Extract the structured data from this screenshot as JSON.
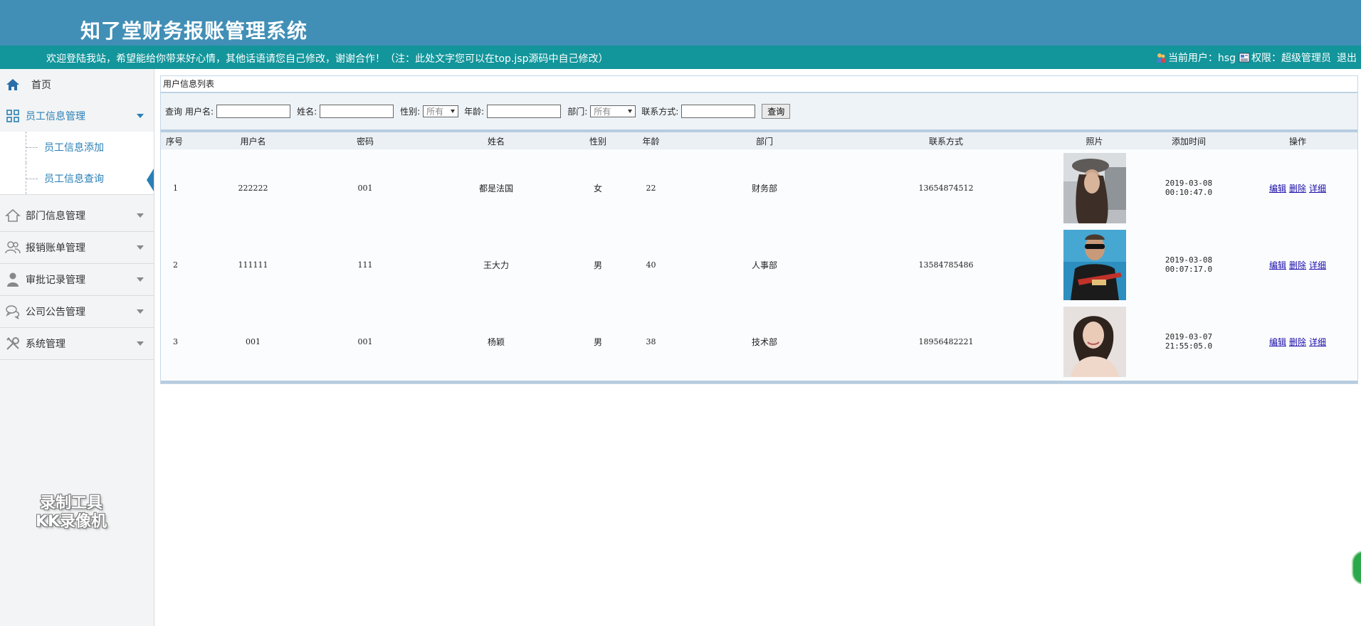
{
  "app": {
    "title": "知了堂财务报账管理系统",
    "welcome": "欢迎登陆我站，希望能给你带来好心情，其他话语请您自己修改，谢谢合作！（注：此处文字您可以在top.jsp源码中自己修改）",
    "current_user_label": "当前用户：hsg",
    "permission_label": "权限：超级管理员",
    "logout": "退出"
  },
  "sidebar": {
    "home": "首页",
    "groups": [
      {
        "label": "员工信息管理",
        "icon": "grid-icon"
      },
      {
        "label": "部门信息管理",
        "icon": "house-icon"
      },
      {
        "label": "报销账单管理",
        "icon": "users-icon"
      },
      {
        "label": "审批记录管理",
        "icon": "person-icon"
      },
      {
        "label": "公司公告管理",
        "icon": "chat-icon"
      },
      {
        "label": "系统管理",
        "icon": "tools-icon"
      }
    ],
    "sub_items": [
      "员工信息添加",
      "员工信息查询"
    ],
    "watermark_line1": "录制工具",
    "watermark_line2": "KK录像机"
  },
  "panel": {
    "title": "用户信息列表"
  },
  "search": {
    "query_label": "查询",
    "username_label": "用户名:",
    "name_label": "姓名:",
    "gender_label": "性别:",
    "gender_selected": "所有",
    "age_label": "年龄:",
    "dept_label": "部门:",
    "dept_selected": "所有",
    "contact_label": "联系方式:",
    "button": "查询"
  },
  "table": {
    "columns": [
      "序号",
      "用户名",
      "密码",
      "姓名",
      "性别",
      "年龄",
      "部门",
      "联系方式",
      "照片",
      "添加时间",
      "操作"
    ],
    "rows": [
      {
        "no": "1",
        "username": "222222",
        "password": "001",
        "name": "都是法国",
        "gender": "女",
        "age": "22",
        "dept": "财务部",
        "contact": "13654874512",
        "photo": "woman-hat-photo",
        "time": "2019-03-08 00:10:47.0"
      },
      {
        "no": "2",
        "username": "111111",
        "password": "111",
        "name": "王大力",
        "gender": "男",
        "age": "40",
        "dept": "人事部",
        "contact": "13584785486",
        "photo": "man-guitar-photo",
        "time": "2019-03-08 00:07:17.0"
      },
      {
        "no": "3",
        "username": "001",
        "password": "001",
        "name": "杨颖",
        "gender": "男",
        "age": "38",
        "dept": "技术部",
        "contact": "18956482221",
        "photo": "woman-portrait-photo",
        "time": "2019-03-07 21:55:05.0"
      }
    ],
    "actions": {
      "edit": "编辑",
      "delete": "删除",
      "detail": "详细"
    }
  },
  "colors": {
    "header": "#418fb6",
    "topbar": "#12959b",
    "link": "#1a0dab",
    "accent": "#2a7fb5"
  }
}
